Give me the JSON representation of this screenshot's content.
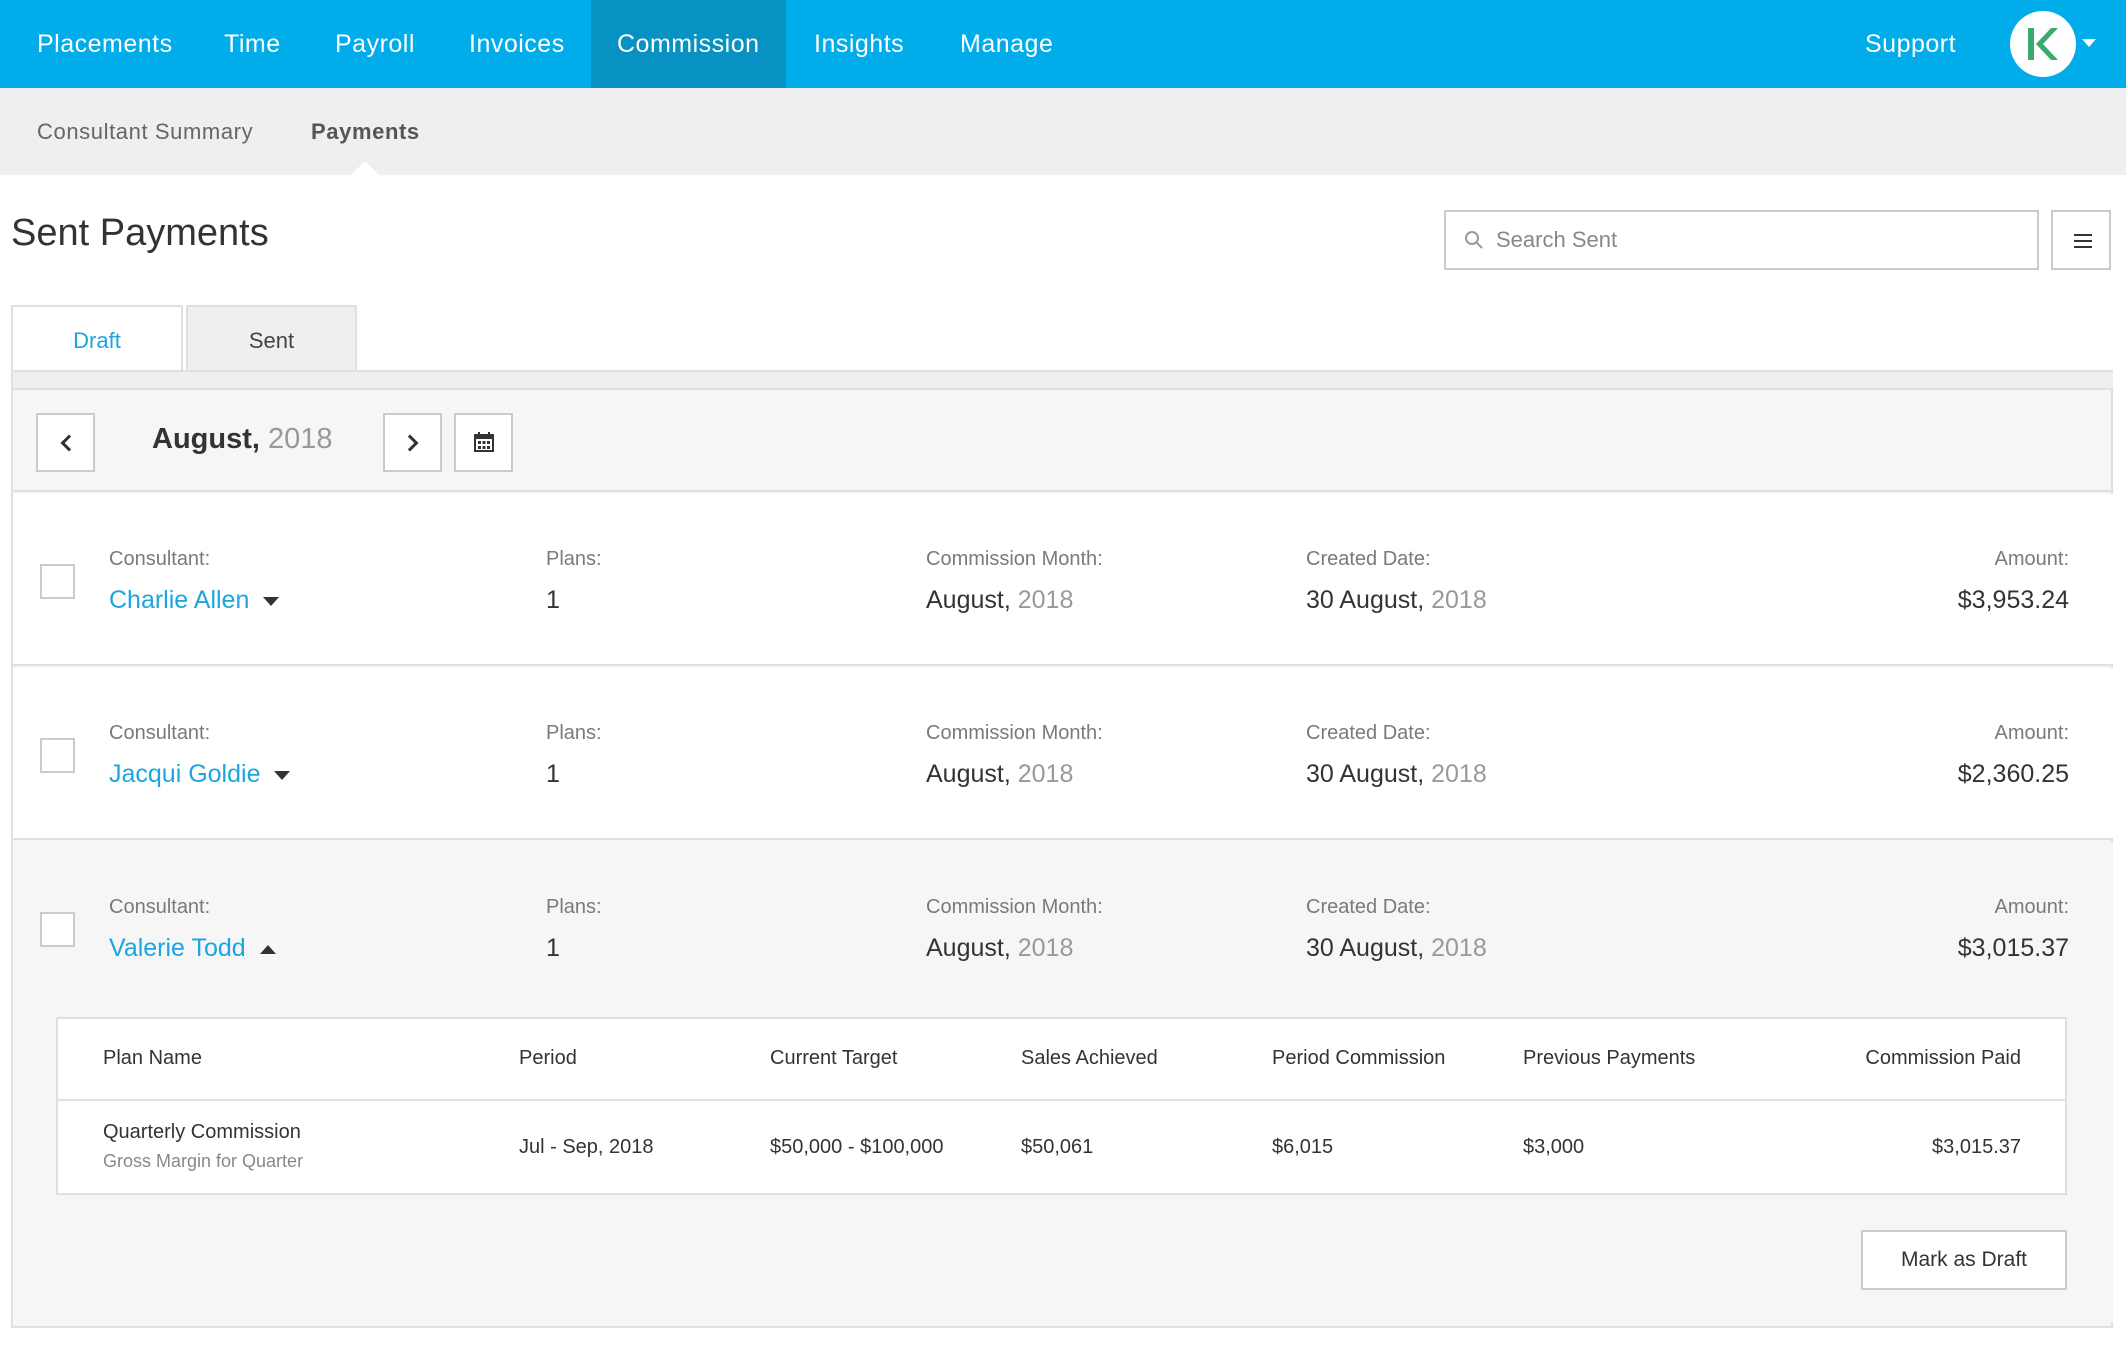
{
  "nav": {
    "items": [
      "Placements",
      "Time",
      "Payroll",
      "Invoices",
      "Commission",
      "Insights",
      "Manage"
    ],
    "active": "Commission",
    "support": "Support",
    "avatar_text": "K"
  },
  "subnav": {
    "items": [
      "Consultant Summary",
      "Payments"
    ],
    "active": "Payments"
  },
  "page": {
    "title": "Sent Payments",
    "search_placeholder": "Search Sent"
  },
  "tabs": [
    {
      "label": "Draft",
      "active": false
    },
    {
      "label": "Sent",
      "active": true
    }
  ],
  "month_bar": {
    "month": "August,",
    "year": "2018"
  },
  "labels": {
    "consultant": "Consultant:",
    "plans": "Plans:",
    "commission_month": "Commission Month:",
    "created_date": "Created Date:",
    "amount": "Amount:"
  },
  "payments": [
    {
      "consultant": "Charlie Allen",
      "plans": "1",
      "commission_month": "August,",
      "commission_year": "2018",
      "created_date": "30 August,",
      "created_year": "2018",
      "amount": "$3,953.24",
      "expanded": false
    },
    {
      "consultant": "Jacqui Goldie",
      "plans": "1",
      "commission_month": "August,",
      "commission_year": "2018",
      "created_date": "30 August,",
      "created_year": "2018",
      "amount": "$2,360.25",
      "expanded": false
    },
    {
      "consultant": "Valerie Todd",
      "plans": "1",
      "commission_month": "August,",
      "commission_year": "2018",
      "created_date": "30 August,",
      "created_year": "2018",
      "amount": "$3,015.37",
      "expanded": true
    }
  ],
  "detail": {
    "columns": [
      "Plan Name",
      "Period",
      "Current Target",
      "Sales Achieved",
      "Period Commission",
      "Previous Payments",
      "Commission Paid"
    ],
    "row": {
      "plan_name": "Quarterly Commission",
      "plan_desc": "Gross Margin for Quarter",
      "period": "Jul - Sep, 2018",
      "current_target": "$50,000 - $100,000",
      "sales_achieved": "$50,061",
      "period_commission": "$6,015",
      "previous_payments": "$3,000",
      "commission_paid": "$3,015.37"
    },
    "action_label": "Mark as Draft"
  },
  "colors": {
    "brand": "#00ace9",
    "brand_active": "#0892c4",
    "link": "#1ba6df",
    "avatar_green": "#3aaa6e"
  },
  "icons": [
    "search-icon",
    "menu-icon",
    "chevron-left-icon",
    "chevron-right-icon",
    "calendar-icon",
    "caret-down-icon",
    "caret-up-icon",
    "logo-icon"
  ]
}
